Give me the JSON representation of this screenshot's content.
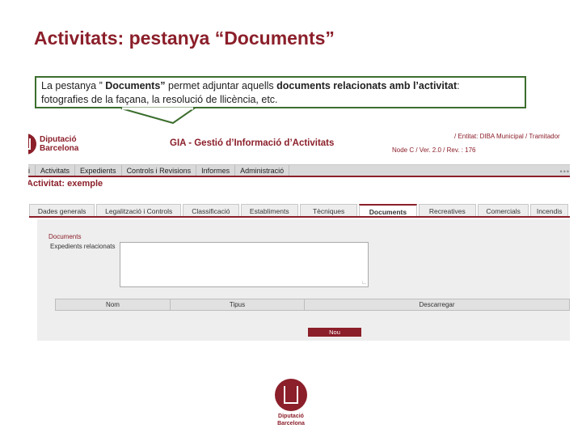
{
  "slide": {
    "title": "Activitats: pestanya “Documents”"
  },
  "callout": {
    "line1_a": "La pestanya ” ",
    "line1_b": "Documents”",
    "line1_c": " permet adjuntar aquells ",
    "line1_d": "documents relacionats amb l’activitat",
    "line1_e": ":",
    "line2": "fotografies de la façana, la resolució de llicència, etc."
  },
  "app": {
    "logo_line1": "Diputació",
    "logo_line2": "Barcelona",
    "title": "GIA - Gestió d’Informació d’Activitats",
    "meta_entitat": "/ Entitat: DIBA Municipal / Tramitador",
    "meta_node": "Node C / Ver. 2.0 / Rev. : 176",
    "menu_dots": "•••",
    "menu": [
      "Inici",
      "Activitats",
      "Expedients",
      "Controls i Revisions",
      "Informes",
      "Administració"
    ],
    "page_heading": "Activitat: exemple",
    "tabs": [
      "Dades generals",
      "Legalització i Controls",
      "Classificació",
      "Establiments",
      "Tècniques",
      "Documents",
      "Recreatives",
      "Comercials",
      "Incendis"
    ],
    "active_tab": "Documents",
    "section_label": "Documents",
    "field_label": "Expedients relacionats",
    "table_headers": [
      "Nom",
      "Tipus",
      "Descarregar"
    ],
    "new_button": "Nou"
  },
  "footer": {
    "logo_line1": "Diputació",
    "logo_line2": "Barcelona"
  },
  "colors": {
    "brand": "#8b1f2a",
    "callout_border": "#3c6e2e"
  }
}
